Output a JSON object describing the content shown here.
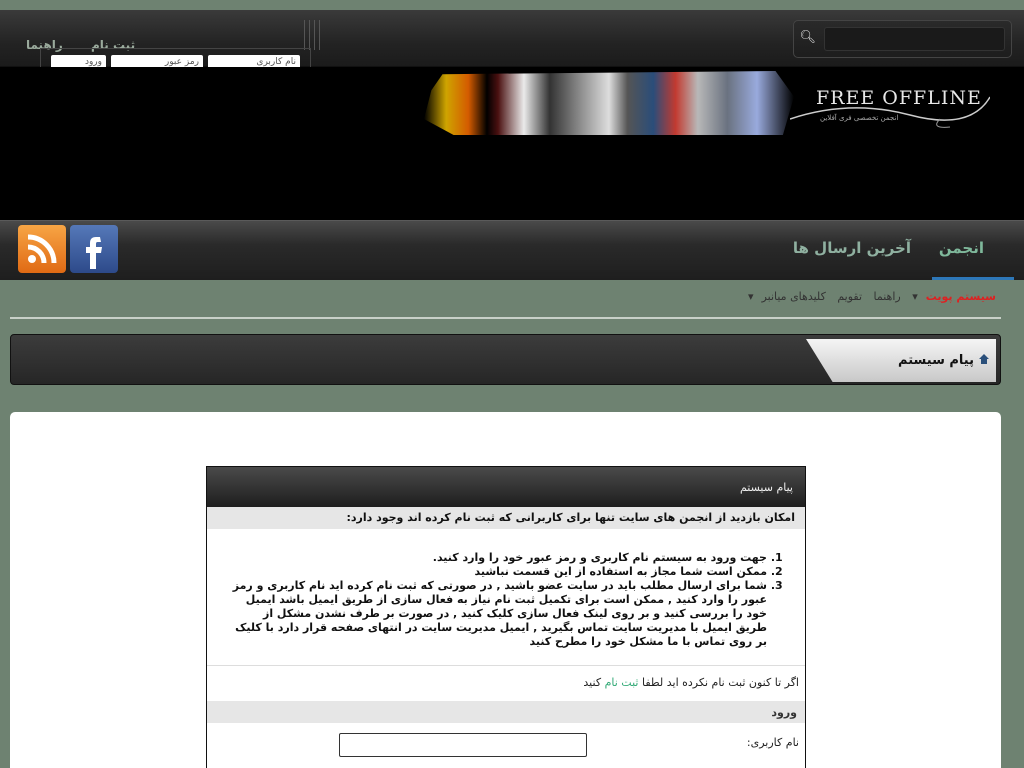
{
  "header": {
    "links": [
      "راهنما",
      "ثبت نام"
    ],
    "login_fields": [
      "نام کاربری",
      "رمز عبور",
      "ورود"
    ]
  },
  "logo": {
    "title": "FREE OFFLINE",
    "subtitle": "انجمن تخصصی فری آفلاین"
  },
  "nav": {
    "tabs": [
      {
        "label": "انجمن",
        "active": true
      },
      {
        "label": "آخرین ارسال ها",
        "active": false
      }
    ],
    "social": [
      "rss-icon",
      "facebook-icon"
    ]
  },
  "subnav": {
    "items": [
      "سیستم پویت",
      "راهنما",
      "تقویم",
      "کلیدهای میانبر"
    ]
  },
  "page_title": "پیام سیستم",
  "message_box": {
    "header": "پیام سیستم",
    "subheader": "امکان بازدید از انجمن های سایت تنها برای کاربرانی که ثبت نام کرده اند وجود دارد:",
    "items": [
      "جهت ورود به سیستم نام کاربری و رمز عبور خود را وارد کنید.",
      "ممکن است شما مجاز به استفاده از این قسمت نباشید",
      "شما برای ارسال مطلب باید در سایت عضو باشید , در صورتی که ثبت نام کرده اید نام کاربری و رمز عبور را وارد کنید , ممکن است برای تکمیل ثبت نام نیاز به فعال سازی از طریق ایمیل باشد ایمیل خود را بررسی کنید و بر روی لینک فعال سازی کلیک کنید , در صورت بر طرف نشدن مشکل از طریق ایمیل با مدیریت سایت تماس بگیرید , ایمیل مدیریت سایت در انتهای صفحه قرار دارد با کلیک بر روی تماس با ما مشکل خود را مطرح کنید"
    ],
    "register_prefix": "اگر تا کنون ثبت نام نکرده اید لطفا",
    "register_link": "ثبت نام",
    "register_suffix": "کنید",
    "login_section": "ورود",
    "username_label": "نام کاربری:"
  },
  "colors": {
    "accent": "#2d77b8",
    "nav_text": "#7fb89b",
    "page_bg": "#6e8271"
  }
}
